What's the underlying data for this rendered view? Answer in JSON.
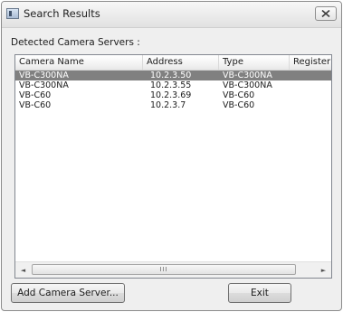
{
  "window": {
    "title": "Search Results",
    "icons": {
      "app": "camera-app-icon",
      "close": "close-icon"
    }
  },
  "section_label": "Detected Camera Servers :",
  "table": {
    "columns": [
      "Camera Name",
      "Address",
      "Type",
      "Register"
    ],
    "rows": [
      {
        "name": "VB-C300NA",
        "address": "10.2.3.50",
        "type": "VB-C300NA",
        "register": "",
        "selected": true
      },
      {
        "name": "VB-C300NA",
        "address": "10.2.3.55",
        "type": "VB-C300NA",
        "register": "",
        "selected": false
      },
      {
        "name": "VB-C60",
        "address": "10.2.3.69",
        "type": "VB-C60",
        "register": "",
        "selected": false
      },
      {
        "name": "VB-C60",
        "address": "10.2.3.7",
        "type": "VB-C60",
        "register": "",
        "selected": false
      }
    ]
  },
  "scrollbar": {
    "left_arrow": "◄",
    "right_arrow": "►",
    "grip": "III"
  },
  "buttons": {
    "add_camera_server": "Add Camera Server...",
    "exit": "Exit"
  },
  "colors": {
    "selection": "#808080",
    "window_bg": "#efefef"
  }
}
